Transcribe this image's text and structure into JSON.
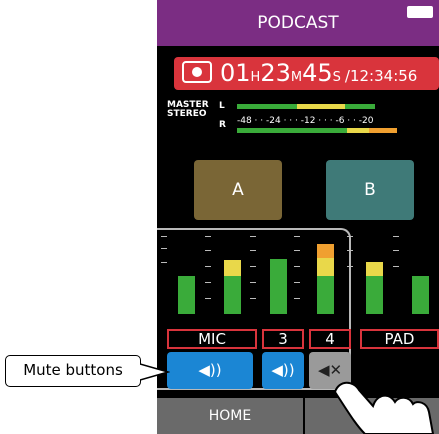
{
  "title": "PODCAST",
  "recorder": {
    "hours": "01",
    "h_unit": "H",
    "minutes": "23",
    "m_unit": "M",
    "seconds": "45",
    "s_unit": "S",
    "remaining": "/12:34:56"
  },
  "meter": {
    "label_line1": "MASTER",
    "label_line2": "STEREO",
    "left": "L",
    "right": "R",
    "scale": "-48 · · -24 · · · -12 · · · -6 · · -20"
  },
  "buttons": {
    "a": "A",
    "b": "B"
  },
  "channels": {
    "mic": "MIC",
    "ch3": "3",
    "ch4": "4",
    "pad": "PAD"
  },
  "mute": {
    "mic": "◀))",
    "ch3": "◀))",
    "ch4": "◀✕"
  },
  "tabs": {
    "home": "HOME"
  },
  "callout": "Mute buttons",
  "colors": {
    "title_bg": "#7b2d83",
    "rec_red": "#d9343c",
    "mute_blue": "#1b86d4",
    "meter_green": "#3aab3a",
    "meter_yellow": "#e9d84a",
    "meter_orange": "#f0a030",
    "button_a": "#7a6636",
    "button_b": "#3f7a78"
  }
}
